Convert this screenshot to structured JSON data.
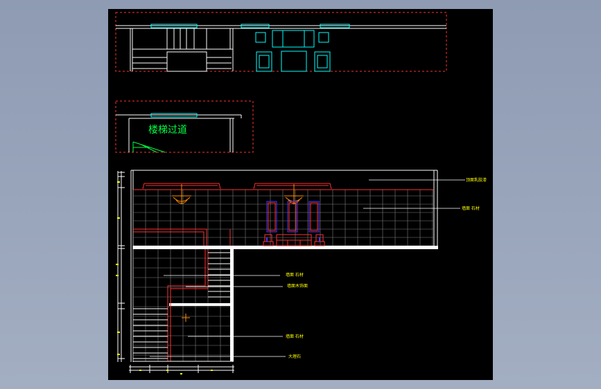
{
  "viewer": {
    "background_color": "#000000",
    "page_gradient": [
      "#8e9bb3",
      "#a3aec2"
    ]
  },
  "plan": {
    "stair_label": "楼梯过道",
    "label_color": "#00ff44"
  },
  "elevation": {
    "callout_labels": [
      "顶面乳胶漆",
      "墙面 石材",
      "墙面 石材",
      "墙面木饰面",
      "墙面 石材",
      "大理石"
    ],
    "callout_color": "#ffff00"
  },
  "colors": {
    "wall": "#ffffff",
    "window": "#00ffff",
    "furniture": "#00ffff",
    "section_line": "#ff3030",
    "grid": "#7f7f7f",
    "chandelier": "#ff8c00",
    "panel": "#5533ff",
    "dimension": "#ffff00"
  }
}
